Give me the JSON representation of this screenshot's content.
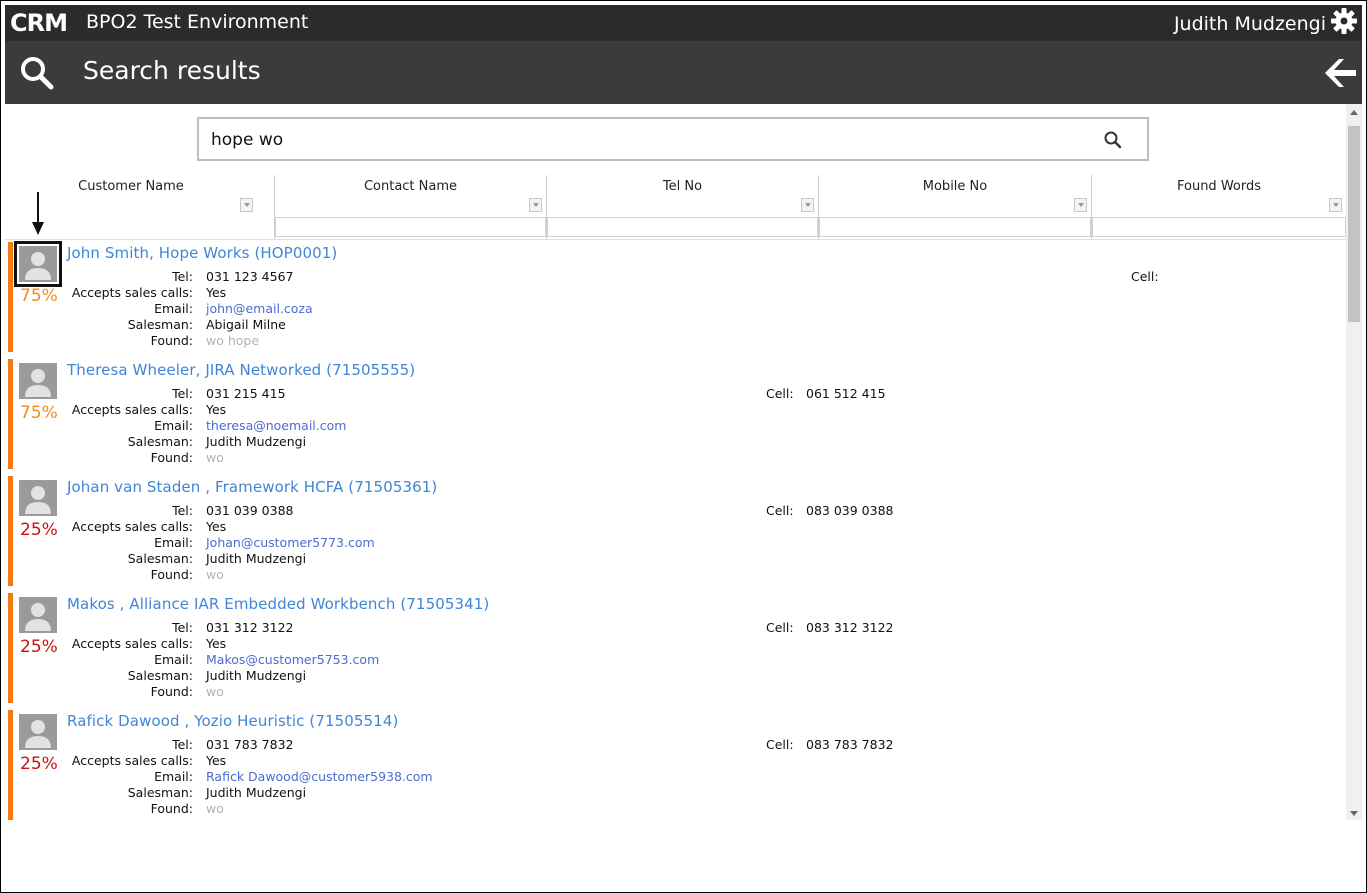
{
  "app": {
    "logo_text": "CRM",
    "title": "BPO2 Test Environment",
    "user": "Judith Mudzengi"
  },
  "header": {
    "page_title": "Search results"
  },
  "search": {
    "value": "hope wo"
  },
  "columns": [
    {
      "label": "Customer Name"
    },
    {
      "label": "Contact Name"
    },
    {
      "label": "Tel No"
    },
    {
      "label": "Mobile No"
    },
    {
      "label": "Found Words"
    }
  ],
  "field_labels": {
    "tel": "Tel:",
    "accepts": "Accepts sales calls:",
    "email": "Email:",
    "salesman": "Salesman:",
    "found": "Found:",
    "cell": "Cell:"
  },
  "colors": {
    "accent_strip": "#f07a14",
    "match_high": "#f08c1c",
    "match_low": "#cc1111",
    "link": "#3f86d6"
  },
  "results": [
    {
      "name": "John Smith, Hope Works (HOP0001)",
      "match": "75%",
      "match_level": "high",
      "tel": "031 123 4567",
      "cell": "",
      "accepts_sales_calls": "Yes",
      "email": "john@email.coza",
      "salesman": "Abigail Milne",
      "found": "wo hope"
    },
    {
      "name": "Theresa Wheeler, JIRA Networked (71505555)",
      "match": "75%",
      "match_level": "high",
      "tel": "031 215 415",
      "cell": "061 512 415",
      "accepts_sales_calls": "Yes",
      "email": "theresa@noemail.com",
      "salesman": "Judith Mudzengi",
      "found": "wo"
    },
    {
      "name": "Johan van Staden , Framework HCFA (71505361)",
      "match": "25%",
      "match_level": "low",
      "tel": "031 039 0388",
      "cell": "083 039 0388",
      "accepts_sales_calls": "Yes",
      "email": "Johan@customer5773.com",
      "salesman": "Judith Mudzengi",
      "found": "wo"
    },
    {
      "name": "Makos , Alliance IAR Embedded Workbench (71505341)",
      "match": "25%",
      "match_level": "low",
      "tel": "031 312 3122",
      "cell": "083 312 3122",
      "accepts_sales_calls": "Yes",
      "email": "Makos@customer5753.com",
      "salesman": "Judith Mudzengi",
      "found": "wo"
    },
    {
      "name": "Rafick Dawood , Yozio Heuristic (71505514)",
      "match": "25%",
      "match_level": "low",
      "tel": "031 783 7832",
      "cell": "083 783 7832",
      "accepts_sales_calls": "Yes",
      "email": "Rafick Dawood@customer5938.com",
      "salesman": "Judith Mudzengi",
      "found": "wo"
    }
  ]
}
